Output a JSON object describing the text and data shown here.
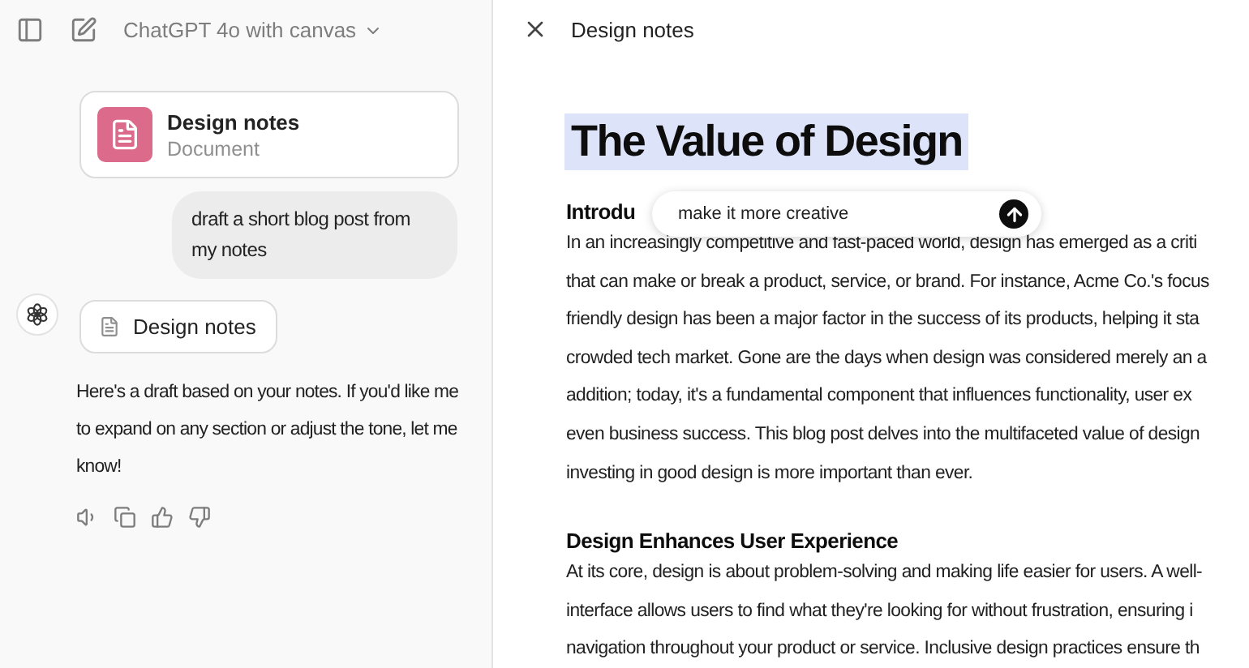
{
  "sidebar": {
    "model_title": "ChatGPT 4o with canvas",
    "attachment": {
      "title": "Design notes",
      "subtitle": "Document"
    },
    "user_message": "draft a short blog post from my notes",
    "canvas_chip": "Design notes",
    "reply": "Here's a draft based on your notes. If you'd like me to expand on any section or adjust the tone, let me know!"
  },
  "canvas": {
    "title": "Design notes",
    "doc_title": "The Value of Design",
    "doc_title_selected": true,
    "edit_prompt": {
      "value": "make it more creative"
    },
    "sections": [
      {
        "heading": "Introdu",
        "lines": [
          "In an increasingly competitive and fast-paced world, design has emerged as a criti",
          "that can make or break a product, service, or brand. For instance, Acme Co.'s focus",
          "friendly design has been a major factor in the success of its products, helping it sta",
          "crowded tech market. Gone are the days when design was considered merely an a",
          "addition; today, it's a fundamental component that influences functionality, user ex",
          "even business success. This blog post delves into the multifaceted value of design",
          "investing in good design is more important than ever."
        ]
      },
      {
        "heading": "Design Enhances User Experience",
        "lines": [
          "At its core, design is about problem-solving and making life easier for users. A well-",
          "interface allows users to find what they're looking for without frustration, ensuring i",
          "navigation throughout your product or service. Inclusive design practices ensure th"
        ]
      }
    ]
  }
}
